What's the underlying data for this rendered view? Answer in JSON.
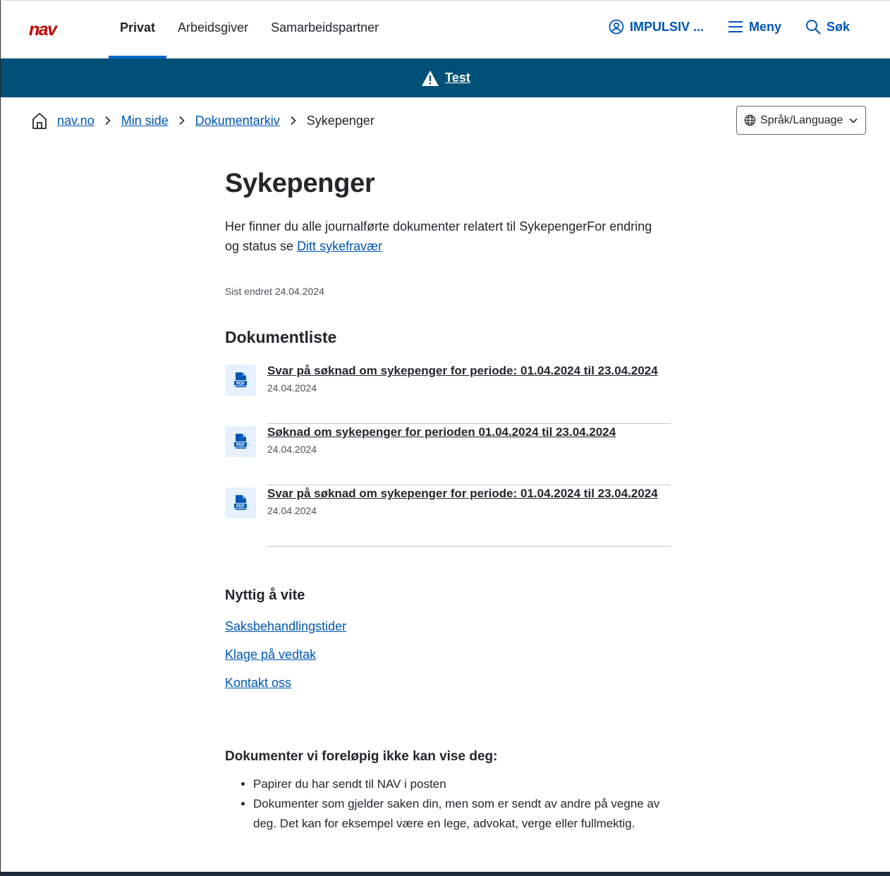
{
  "header": {
    "logo_text": "nav",
    "tabs": [
      {
        "label": "Privat",
        "active": true
      },
      {
        "label": "Arbeidsgiver",
        "active": false
      },
      {
        "label": "Samarbeidspartner",
        "active": false
      }
    ],
    "user_label": "IMPULSIV ...",
    "menu_label": "Meny",
    "search_label": "Søk",
    "accent_color": "#0067c5",
    "logo_color": "#c30000"
  },
  "banner": {
    "label": "Test",
    "background": "#005077",
    "icon": "warning-icon"
  },
  "breadcrumb": {
    "items": [
      "nav.no",
      "Min side",
      "Dokumentarkiv"
    ],
    "current": "Sykepenger"
  },
  "language": {
    "label": "Språk/Language"
  },
  "main": {
    "title": "Sykepenger",
    "intro_text": "Her finner du alle journalførte dokumenter relatert til SykepengerFor endring og status se ",
    "intro_link": "Ditt sykefravær",
    "last_changed": "Sist endret 24.04.2024",
    "doc_section_title": "Dokumentliste",
    "documents": [
      {
        "title": "Svar på søknad om sykepenger for periode: 01.04.2024 til 23.04.2024",
        "date": "24.04.2024",
        "icon": "pdf-icon"
      },
      {
        "title": "Søknad om sykepenger for perioden 01.04.2024 til 23.04.2024",
        "date": "24.04.2024",
        "icon": "pdf-icon"
      },
      {
        "title": "Svar på søknad om sykepenger for periode: 01.04.2024 til 23.04.2024",
        "date": "24.04.2024",
        "icon": "pdf-icon"
      }
    ],
    "useful_title": "Nyttig å vite",
    "useful_links": [
      "Saksbehandlingstider",
      "Klage på vedtak",
      "Kontakt oss"
    ],
    "not_shown_title": "Dokumenter vi foreløpig ikke kan vise deg:",
    "not_shown_items": [
      "Papirer du har sendt til NAV i posten",
      "Dokumenter som gjelder saken din, men som er sendt av andre på vegne av deg. Det kan for eksempel være en lege, advokat, verge eller fullmektig."
    ]
  }
}
